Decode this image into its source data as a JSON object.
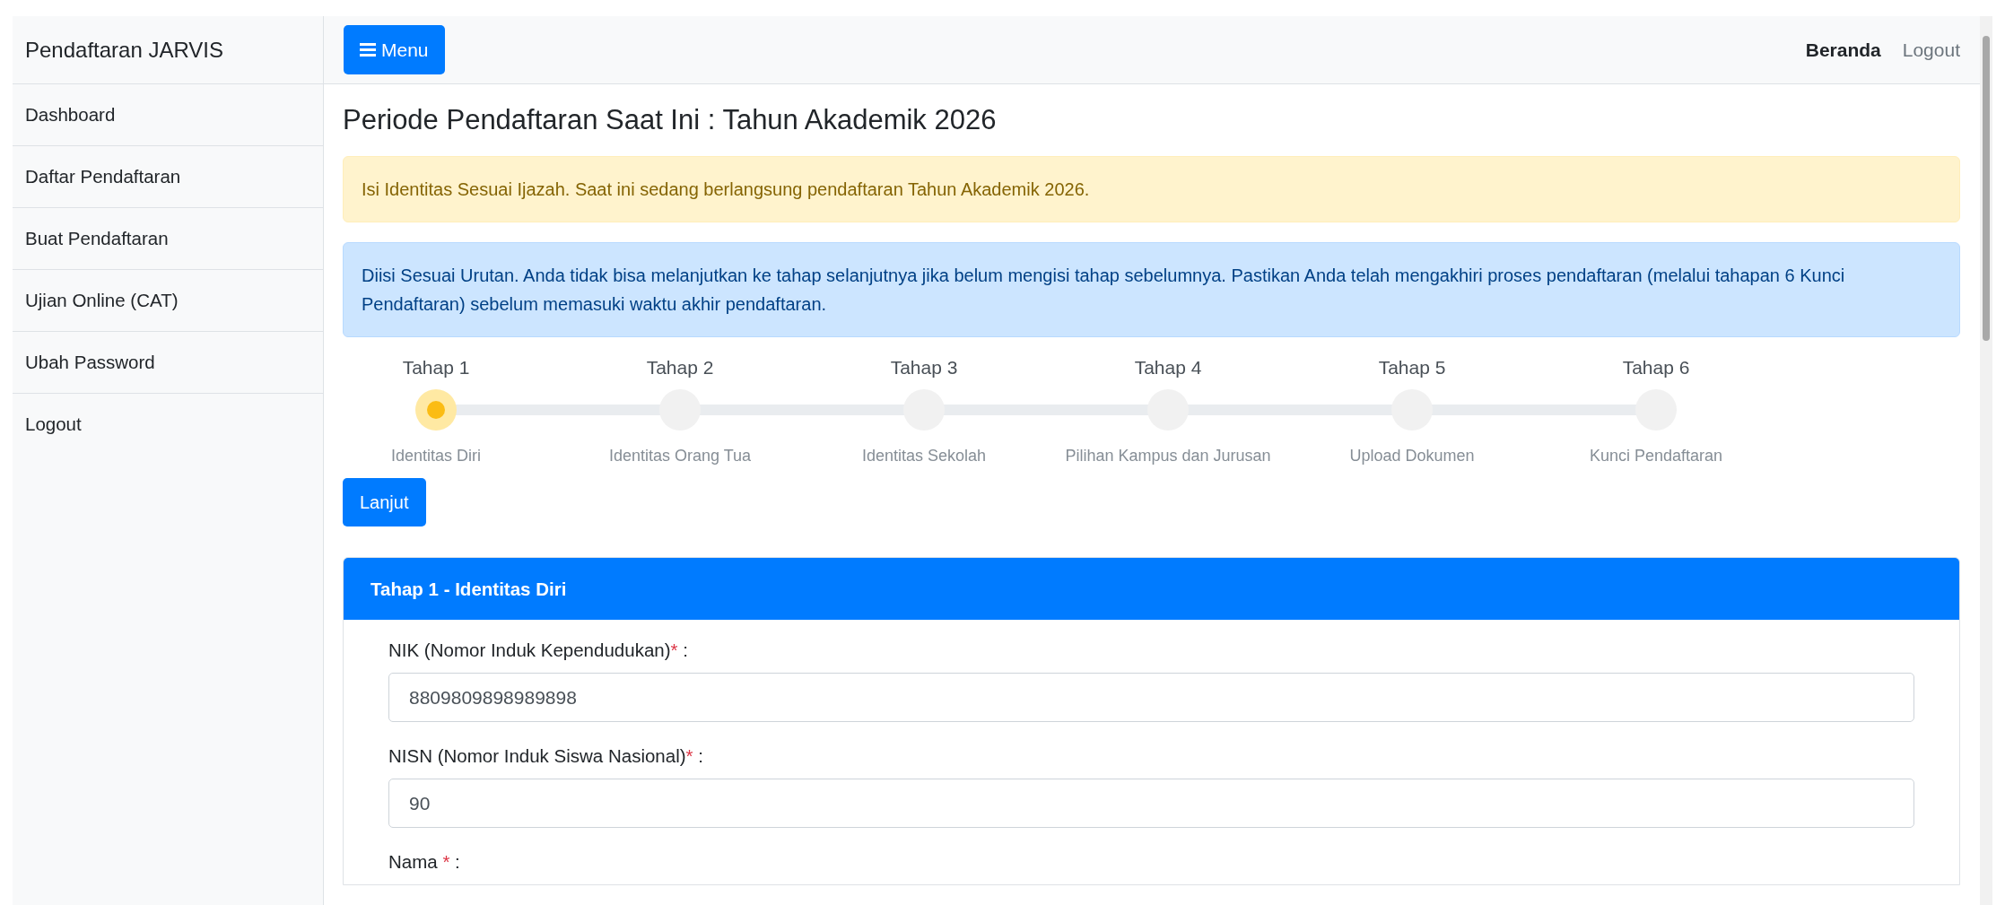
{
  "sidebar": {
    "title": "Pendaftaran JARVIS",
    "items": [
      {
        "label": "Dashboard"
      },
      {
        "label": "Daftar Pendaftaran"
      },
      {
        "label": "Buat Pendaftaran"
      },
      {
        "label": "Ujian Online (CAT)"
      },
      {
        "label": "Ubah Password"
      },
      {
        "label": "Logout"
      }
    ]
  },
  "topbar": {
    "menu_button": "Menu",
    "links": [
      {
        "label": "Beranda",
        "selected": true
      },
      {
        "label": "Logout",
        "selected": false
      }
    ]
  },
  "page_title": "Periode Pendaftaran Saat Ini : Tahun Akademik 2026",
  "alerts": [
    {
      "kind": "warning",
      "text": "Isi Identitas Sesuai Ijazah. Saat ini sedang berlangsung pendaftaran Tahun Akademik 2026."
    },
    {
      "kind": "info",
      "text": "Diisi Sesuai Urutan. Anda tidak bisa melanjutkan ke tahap selanjutnya jika belum mengisi tahap sebelumnya. Pastikan Anda telah mengakhiri proses pendaftaran (melalui tahapan 6 Kunci Pendaftaran) sebelum memasuki waktu akhir pendaftaran."
    }
  ],
  "steps": [
    {
      "title": "Tahap 1",
      "label": "Identitas Diri",
      "selected": true
    },
    {
      "title": "Tahap 2",
      "label": "Identitas Orang Tua",
      "selected": false
    },
    {
      "title": "Tahap 3",
      "label": "Identitas Sekolah",
      "selected": false
    },
    {
      "title": "Tahap 4",
      "label": "Pilihan Kampus dan Jurusan",
      "selected": false
    },
    {
      "title": "Tahap 5",
      "label": "Upload Dokumen",
      "selected": false
    },
    {
      "title": "Tahap 6",
      "label": "Kunci Pendaftaran",
      "selected": false
    }
  ],
  "next_button": "Lanjut",
  "form": {
    "title": "Tahap 1 - Identitas Diri",
    "fields": [
      {
        "label": "NIK (Nomor Induk Kependudukan)",
        "required_mark": "*",
        "suffix": ":",
        "value": "8809809898989898"
      },
      {
        "label": "NISN (Nomor Induk Siswa Nasional)",
        "required_mark": "*",
        "suffix": ":",
        "value": "90"
      },
      {
        "label": "Nama ",
        "required_mark": "*",
        "suffix": ":"
      }
    ]
  }
}
